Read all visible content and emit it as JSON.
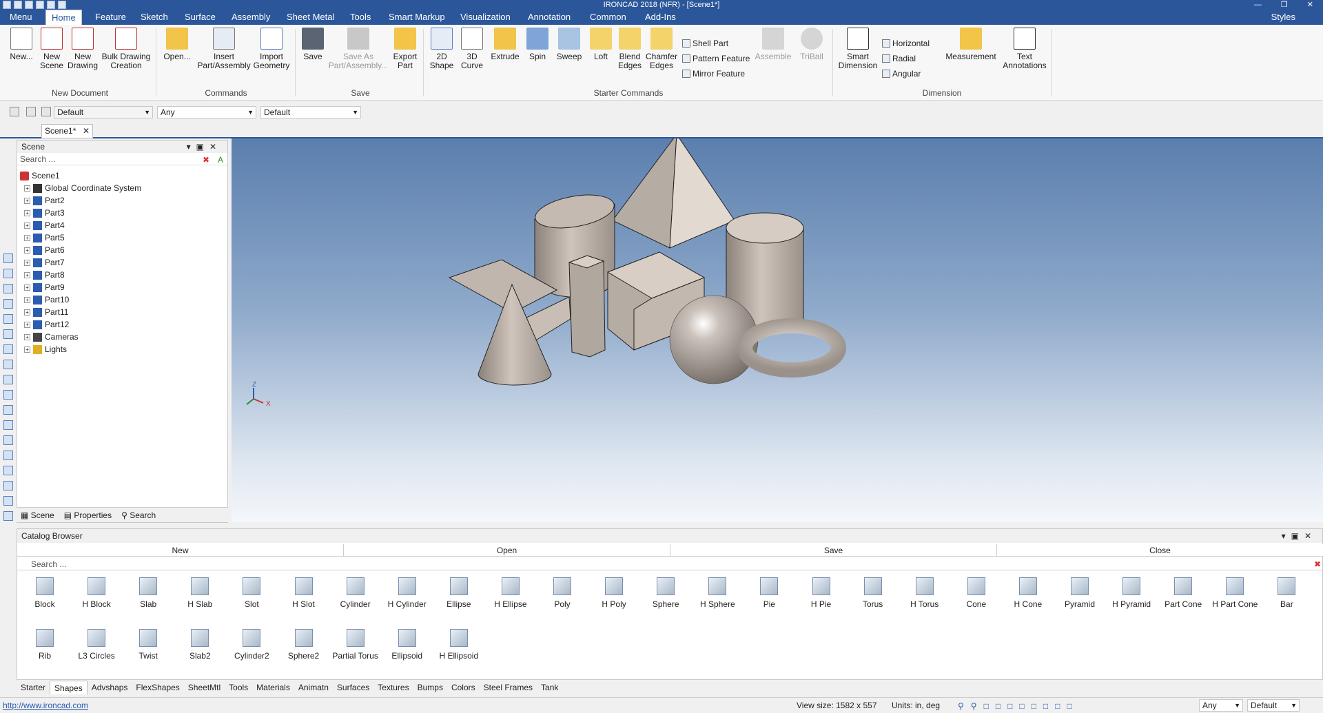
{
  "window": {
    "title": "IRONCAD 2018 (NFR) - [Scene1*]"
  },
  "tabs": [
    "Menu",
    "Home",
    "Feature",
    "Sketch",
    "Surface",
    "Assembly",
    "Sheet Metal",
    "Tools",
    "Smart Markup",
    "Visualization",
    "Annotation",
    "Common",
    "Add-Ins"
  ],
  "styles_label": "Styles",
  "ribbon": {
    "new_document": {
      "group": "New Document",
      "new": "New...",
      "new_scene": "New Scene",
      "new_drawing": "New Drawing",
      "bulk": "Bulk Drawing Creation"
    },
    "commands": {
      "group": "Commands",
      "open": "Open...",
      "insert": "Insert Part/Assembly",
      "import": "Import Geometry"
    },
    "save": {
      "group": "Save",
      "save": "Save",
      "save_as": "Save As Part/Assembly...",
      "export": "Export Part"
    },
    "starter": {
      "group": "Starter Commands",
      "shape2d": "2D Shape",
      "curve3d": "3D Curve",
      "extrude": "Extrude",
      "spin": "Spin",
      "sweep": "Sweep",
      "loft": "Loft",
      "blend": "Blend Edges",
      "chamfer": "Chamfer Edges",
      "shell": "Shell Part",
      "pattern": "Pattern Feature",
      "mirror": "Mirror Feature",
      "assemble": "Assemble",
      "triball": "TriBall"
    },
    "dimension": {
      "group": "Dimension",
      "smart": "Smart Dimension",
      "horizontal": "Horizontal",
      "radial": "Radial",
      "angular": "Angular",
      "measurement": "Measurement",
      "text": "Text Annotations"
    }
  },
  "propbar": {
    "combo1": "Default",
    "combo2": "Any",
    "combo3": "Default"
  },
  "doc_tab": "Scene1*",
  "scene_panel": {
    "title": "Scene",
    "search_placeholder": "Search ...",
    "root": "Scene1",
    "nodes": [
      "Global Coordinate System",
      "Part2",
      "Part3",
      "Part4",
      "Part5",
      "Part6",
      "Part7",
      "Part8",
      "Part9",
      "Part10",
      "Part11",
      "Part12",
      "Cameras",
      "Lights"
    ],
    "footer": {
      "scene": "Scene",
      "properties": "Properties",
      "search": "Search"
    }
  },
  "viewport": {
    "axis_z": "Z",
    "axis_x": "X"
  },
  "catalog": {
    "title": "Catalog Browser",
    "bar": [
      "New",
      "Open",
      "Save",
      "Close"
    ],
    "search_placeholder": "Search ...",
    "row1": [
      "Block",
      "H Block",
      "Slab",
      "H Slab",
      "Slot",
      "H Slot",
      "Cylinder",
      "H Cylinder",
      "Ellipse",
      "H Ellipse",
      "Poly",
      "H Poly",
      "Sphere",
      "H Sphere",
      "Pie",
      "H Pie",
      "Torus",
      "H Torus",
      "Cone",
      "H Cone",
      "Pyramid",
      "H Pyramid",
      "Part Cone",
      "H Part Cone",
      "Bar"
    ],
    "row2": [
      "Rib",
      "L3 Circles",
      "Twist",
      "Slab2",
      "Cylinder2",
      "Sphere2",
      "Partial Torus",
      "Ellipsoid",
      "H Ellipsoid"
    ],
    "tabs": [
      "Starter",
      "Shapes",
      "Advshaps",
      "FlexShapes",
      "SheetMtl",
      "Tools",
      "Materials",
      "Animatn",
      "Surfaces",
      "Textures",
      "Bumps",
      "Colors",
      "Steel Frames",
      "Tank"
    ],
    "active_tab": "Shapes"
  },
  "status": {
    "url": "http://www.ironcad.com",
    "view_size": "View size: 1582 x 557",
    "units": "Units: in, deg",
    "combo1": "Any",
    "combo2": "Default"
  }
}
